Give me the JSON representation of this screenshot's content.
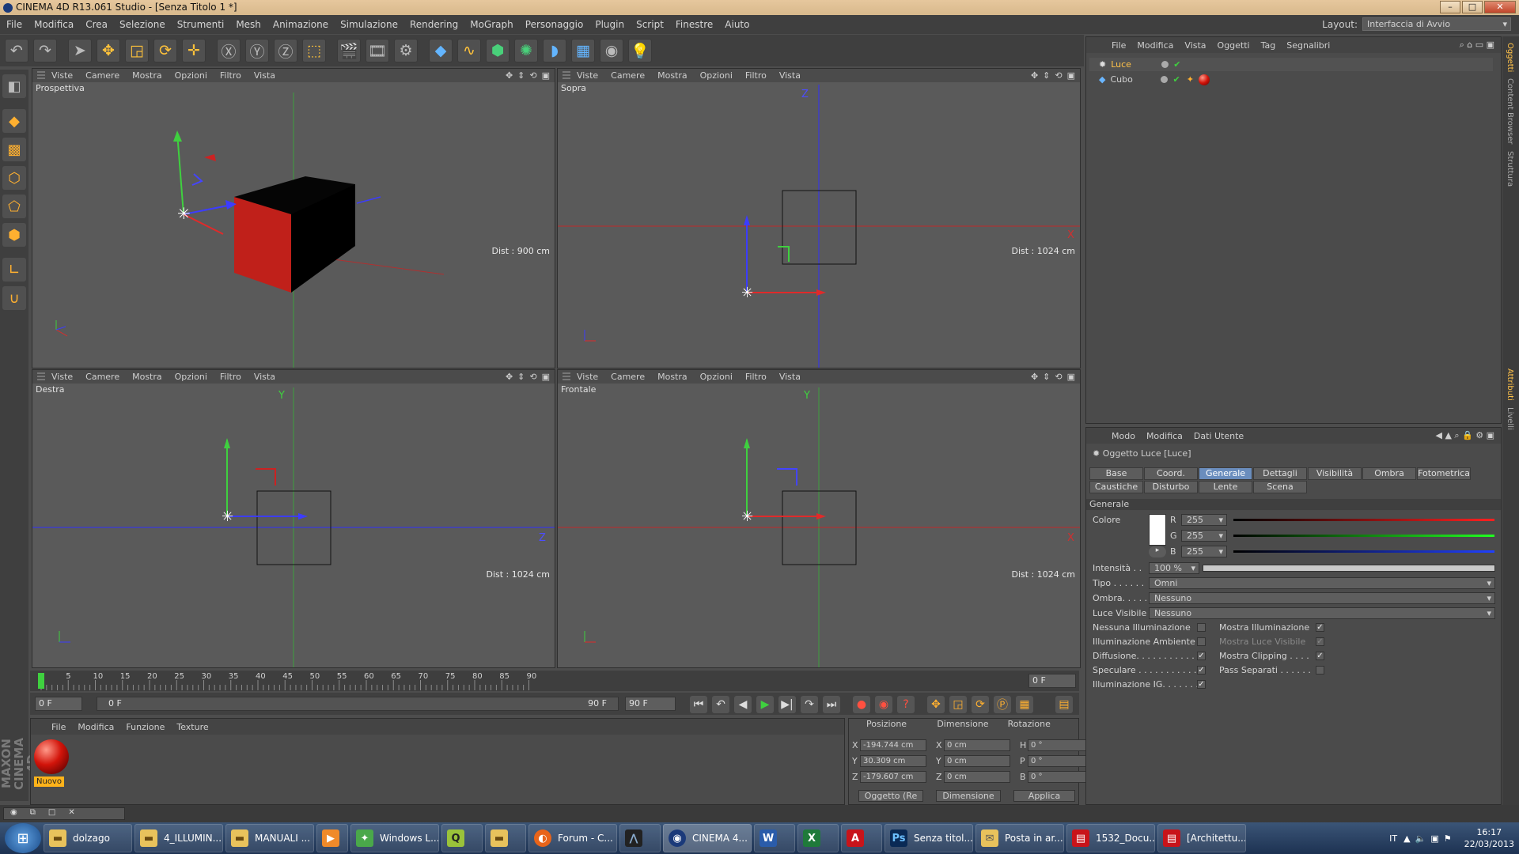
{
  "window": {
    "title": "CINEMA 4D R13.061 Studio - [Senza Titolo 1 *]",
    "buttons": [
      "–",
      "□",
      "✕"
    ]
  },
  "menubar": [
    "File",
    "Modifica",
    "Crea",
    "Selezione",
    "Strumenti",
    "Mesh",
    "Animazione",
    "Simulazione",
    "Rendering",
    "MoGraph",
    "Personaggio",
    "Plugin",
    "Script",
    "Finestre",
    "Aiuto"
  ],
  "layout": {
    "label": "Layout:",
    "value": "Interfaccia di Avvio"
  },
  "viewport_menu": [
    "Viste",
    "Camere",
    "Mostra",
    "Opzioni",
    "Filtro",
    "Vista"
  ],
  "viewports": [
    {
      "name": "Prospettiva",
      "dist": "Dist : 900 cm"
    },
    {
      "name": "Sopra",
      "dist": "Dist : 1024 cm"
    },
    {
      "name": "Destra",
      "dist": "Dist : 1024 cm"
    },
    {
      "name": "Frontale",
      "dist": "Dist : 1024 cm"
    }
  ],
  "axis_labels": {
    "x": "X",
    "y": "Y",
    "z": "Z"
  },
  "timeline": {
    "ticks": [
      "0",
      "5",
      "10",
      "15",
      "20",
      "25",
      "30",
      "35",
      "40",
      "45",
      "50",
      "55",
      "60",
      "65",
      "70",
      "75",
      "80",
      "85",
      "90"
    ],
    "current": "0 F",
    "start": "0 F",
    "range_start": "0 F",
    "range_end": "90 F",
    "end": "90 F"
  },
  "material_menu": [
    "File",
    "Modifica",
    "Funzione",
    "Texture"
  ],
  "material": {
    "name": "Nuovo"
  },
  "coords": {
    "headers": [
      "Posizione",
      "Dimensione",
      "Rotazione"
    ],
    "rows": [
      {
        "a": "X",
        "pos": "-194.744 cm",
        "b": "X",
        "dim": "0 cm",
        "c": "H",
        "rot": "0 °"
      },
      {
        "a": "Y",
        "pos": "30.309 cm",
        "b": "Y",
        "dim": "0 cm",
        "c": "P",
        "rot": "0 °"
      },
      {
        "a": "Z",
        "pos": "-179.607 cm",
        "b": "Z",
        "dim": "0 cm",
        "c": "B",
        "rot": "0 °"
      }
    ],
    "mode": "Oggetto (Re",
    "dim_mode": "Dimensione",
    "apply": "Applica"
  },
  "object_menu": [
    "File",
    "Modifica",
    "Vista",
    "Oggetti",
    "Tag",
    "Segnalibri"
  ],
  "objects": [
    {
      "name": "Luce",
      "color": "#ffc24a"
    },
    {
      "name": "Cubo",
      "color": "#d0d0d0"
    }
  ],
  "attr_menu": [
    "Modo",
    "Modifica",
    "Dati Utente"
  ],
  "attr_title": "Oggetto Luce [Luce]",
  "attr_tabs": [
    "Base",
    "Coord.",
    "Generale",
    "Dettagli",
    "Visibilità",
    "Ombra",
    "Fotometrica",
    "Caustiche",
    "Disturbo",
    "Lente",
    "Scena"
  ],
  "attr_section": "Generale",
  "colore": {
    "label": "Colore",
    "r_label": "R",
    "g_label": "G",
    "b_label": "B",
    "r": "255",
    "g": "255",
    "b": "255"
  },
  "intensita": {
    "label": "Intensità . .",
    "value": "100 %"
  },
  "tipo": {
    "label": "Tipo . . . . . .",
    "value": "Omni"
  },
  "ombra": {
    "label": "Ombra. . . . .",
    "value": "Nessuno"
  },
  "luce_visibile": {
    "label": "Luce Visibile",
    "value": "Nessuno"
  },
  "checks_left": [
    {
      "label": "Nessuna Illuminazione",
      "checked": false
    },
    {
      "label": "Illuminazione Ambiente",
      "checked": false
    },
    {
      "label": "Diffusione. . . . . . . . . . . .",
      "checked": true
    },
    {
      "label": "Speculare . . . . . . . . . . .",
      "checked": true
    },
    {
      "label": "Illuminazione IG. . . . . . . .",
      "checked": true
    }
  ],
  "checks_right": [
    {
      "label": "Mostra Illuminazione",
      "checked": true
    },
    {
      "label": "Mostra Luce Visibile",
      "checked": true
    },
    {
      "label": "Mostra Clipping . . . .",
      "checked": true
    },
    {
      "label": "Pass Separati . . . . . .",
      "checked": false
    }
  ],
  "right_strip": [
    "Oggetti",
    "Content Browser",
    "Struttura",
    "Attributi",
    "Livelli"
  ],
  "taskbar": [
    {
      "label": "dolzago",
      "icon": "folder-icon"
    },
    {
      "label": "4_ILLUMIN...",
      "icon": "folder-icon"
    },
    {
      "label": "MANUALI ...",
      "icon": "folder-icon"
    },
    {
      "label": "",
      "icon": "media-player-icon"
    },
    {
      "label": "Windows L...",
      "icon": "windows-live-icon"
    },
    {
      "label": "",
      "icon": "app-icon"
    },
    {
      "label": "",
      "icon": "folder-icon"
    },
    {
      "label": "Forum - C...",
      "icon": "firefox-icon"
    },
    {
      "label": "",
      "icon": "app-icon"
    },
    {
      "label": "CINEMA 4...",
      "icon": "cinema4d-icon"
    },
    {
      "label": "",
      "icon": "word-icon"
    },
    {
      "label": "",
      "icon": "excel-icon"
    },
    {
      "label": "",
      "icon": "acrobat-icon"
    },
    {
      "label": "Senza titol...",
      "icon": "photoshop-icon"
    },
    {
      "label": "Posta in ar...",
      "icon": "mail-icon"
    },
    {
      "label": "1532_Docu...",
      "icon": "pdf-icon"
    },
    {
      "label": "[Architettu...",
      "icon": "pdf-icon"
    }
  ],
  "tray": {
    "lang": "IT",
    "time": "16:17",
    "date": "22/03/2013"
  }
}
